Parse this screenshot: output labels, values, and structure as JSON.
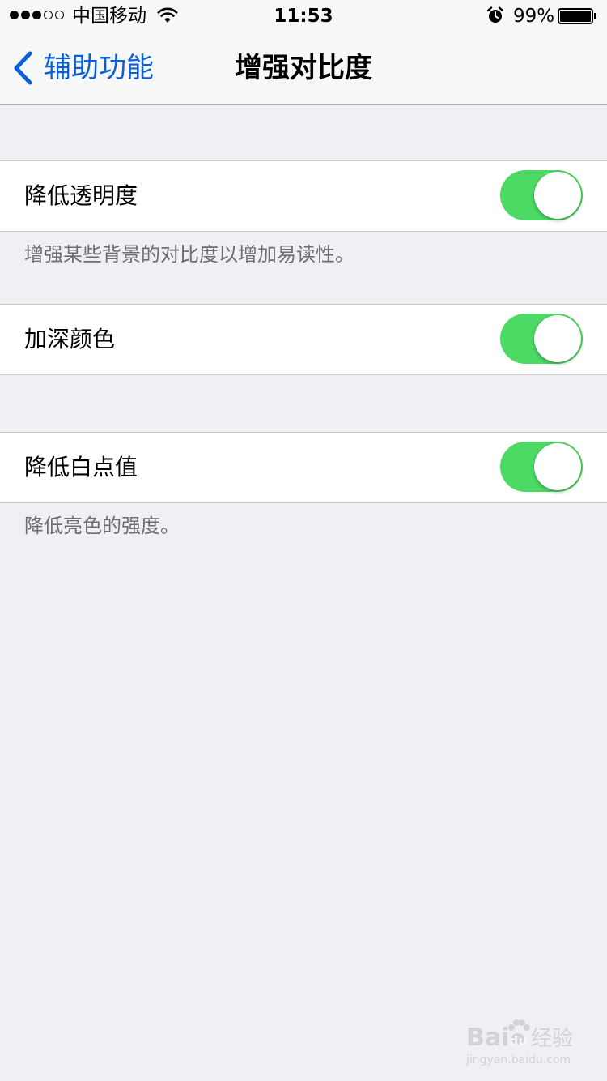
{
  "status_bar": {
    "signal_filled": 3,
    "signal_total": 5,
    "carrier": "中国移动",
    "time": "11:53",
    "battery_percent": "99%",
    "battery_level": 0.99
  },
  "nav": {
    "back_label": "辅助功能",
    "title": "增强对比度"
  },
  "settings": [
    {
      "label": "降低透明度",
      "enabled": true,
      "footer": "增强某些背景的对比度以增加易读性。"
    },
    {
      "label": "加深颜色",
      "enabled": true,
      "footer": ""
    },
    {
      "label": "降低白点值",
      "enabled": true,
      "footer": "降低亮色的强度。"
    }
  ],
  "watermark": {
    "brand": "Bai",
    "brand_suffix": "du",
    "cn": "经验",
    "url": "jingyan.baidu.com"
  },
  "colors": {
    "accent": "#0a5fd9",
    "switch_on": "#4cd964",
    "background": "#efeff4",
    "footer_text": "#6d6d72"
  },
  "icons": {
    "back": "chevron-left-icon",
    "wifi": "wifi-icon",
    "alarm": "alarm-clock-icon",
    "battery": "battery-icon"
  }
}
